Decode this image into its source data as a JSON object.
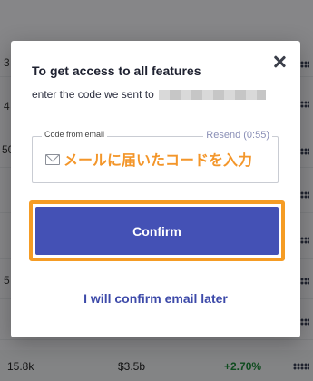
{
  "background_page": {
    "edge_numbers": [
      "3",
      "4",
      "50",
      "5"
    ],
    "bottom_row": {
      "volume": "15.8k",
      "price": "$3.5b",
      "change": "+2.70%"
    }
  },
  "modal": {
    "title": "To get access to all features",
    "subtitle": "enter the code we sent to",
    "email_masked": true,
    "close_icon": "close-icon",
    "code_field": {
      "label": "Code from email",
      "resend": "Resend (0:55)",
      "placeholder": "メールに届いたコードを入力",
      "value": "",
      "icon": "mail-icon"
    },
    "confirm_label": "Confirm",
    "later_label": "I will confirm email later"
  },
  "colors": {
    "accent": "#4451b5",
    "highlight": "#f59c24",
    "link": "#3d4aa9",
    "resend": "#8a8fb6",
    "positive": "#1d8a3a"
  }
}
